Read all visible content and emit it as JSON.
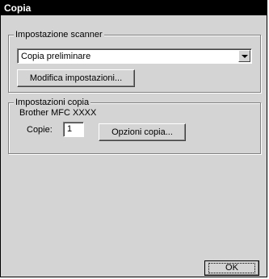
{
  "window": {
    "title": "Copia"
  },
  "scanner": {
    "group_label": "Impostazione scanner",
    "dropdown_value": "Copia preliminare",
    "modify_button": "Modifica impostazioni..."
  },
  "copy": {
    "group_label": "Impostazioni copia",
    "device": "Brother MFC XXXX",
    "copies_label": "Copie:",
    "copies_value": "1",
    "options_button": "Opzioni copia..."
  },
  "footer": {
    "ok_button": "OK"
  }
}
